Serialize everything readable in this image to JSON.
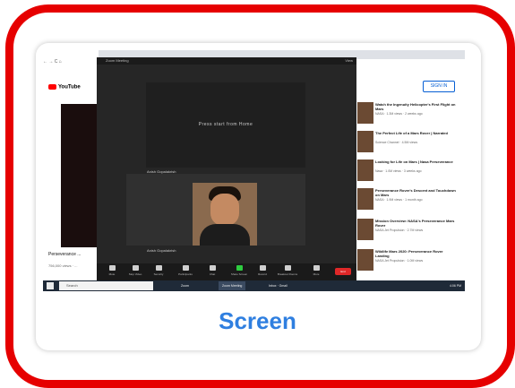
{
  "caption": "Screen",
  "browser": {
    "address": "← → C ⌂",
    "youtube_logo": "YouTube",
    "video_title": "Perseverance ...",
    "video_meta": "756,000 views · ...",
    "sign_in": "SIGN IN",
    "up_next": [
      {
        "title": "Watch the Ingenuity Helicopter's First Flight on Mars",
        "meta": "NASA · 1.3M views · 2 weeks ago"
      },
      {
        "title": "The Perfect Life of a Mars Rover | Narrated",
        "meta": "Science Channel · 4.5M views"
      },
      {
        "title": "Looking for Life on Mars | Nasa Perseverance",
        "meta": "Nasa · 1.0M views · 3 weeks ago"
      },
      {
        "title": "Perseverance Rover's Descent and Touchdown on Mars",
        "meta": "NASA · 1.9M views · 1 month ago"
      },
      {
        "title": "Mission Overview: NASA's Perseverance Mars Rover",
        "meta": "NASA Jet Propulsion · 2.7M views"
      },
      {
        "title": "Wildlife Mars 2020: Perseverance Rover Landing",
        "meta": "NASA Jet Propulsion · 1.0M views"
      }
    ]
  },
  "zoom": {
    "title": "Zoom Meeting",
    "view_label": "View",
    "share_text": "Press start from Home",
    "participant_1": "Anish Gopalakrish",
    "participant_2": "Anish Gopalakrish",
    "toolbar": [
      {
        "label": "Mute",
        "icon": "microphone-icon"
      },
      {
        "label": "Stop Video",
        "icon": "camera-icon"
      },
      {
        "label": "Security",
        "icon": "shield-icon"
      },
      {
        "label": "Participants",
        "icon": "people-icon"
      },
      {
        "label": "Chat",
        "icon": "chat-icon"
      },
      {
        "label": "Share Screen",
        "icon": "share-icon"
      },
      {
        "label": "Record",
        "icon": "record-icon"
      },
      {
        "label": "Breakout Rooms",
        "icon": "rooms-icon"
      },
      {
        "label": "More",
        "icon": "more-icon"
      }
    ],
    "end_label": "End"
  },
  "taskbar": {
    "search_placeholder": "Search",
    "apps": [
      "Zoom",
      "Zoom Meeting",
      "Inbox · Gmail"
    ],
    "tray_time": "4:06 PM"
  },
  "colors": {
    "frame_red": "#e60000",
    "caption_blue": "#2f7fe0",
    "zoom_end_red": "#e02828"
  }
}
